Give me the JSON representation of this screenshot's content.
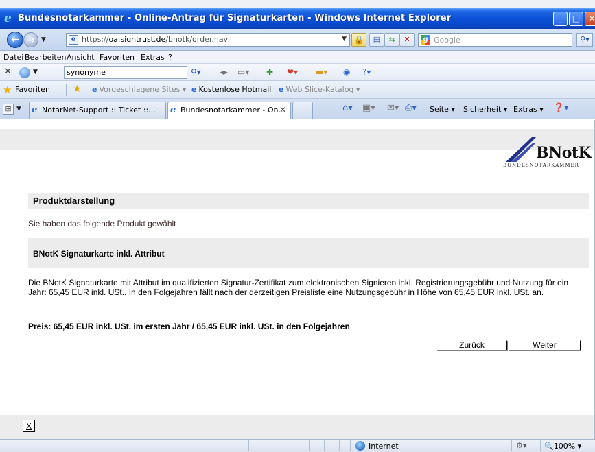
{
  "window": {
    "title": "Bundesnotarkammer - Online-Antrag für Signaturkarten - Windows Internet Explorer"
  },
  "address_bar": {
    "url_prefix": "https://",
    "url_domain": "oa.signtrust.de",
    "url_path": "/bnotk/order.nav",
    "search_placeholder": "Google"
  },
  "menu": {
    "items": [
      "Datei",
      "Bearbeiten",
      "Ansicht",
      "Favoriten",
      "Extras",
      "?"
    ]
  },
  "search_toolbar": {
    "query": "synonyme"
  },
  "favorites_bar": {
    "label": "Favoriten",
    "items": [
      "Vorgeschlagene Sites ▾",
      "Kostenlose Hotmail",
      "Web Slice-Katalog ▾"
    ]
  },
  "tabs": [
    {
      "label": "NotarNet-Support :: Ticket ::...",
      "active": false
    },
    {
      "label": "Bundesnotarkammer - On...",
      "active": true
    }
  ],
  "command_bar": {
    "page": "Seite ▾",
    "security": "Sicherheit ▾",
    "extras": "Extras ▾"
  },
  "page": {
    "logo_text": "BNotK",
    "logo_subtitle": "BUNDESNOTARKAMMER",
    "section_title": "Produktdarstellung",
    "chosen_text": "Sie haben das folgende Produkt gewählt",
    "product_name": "BNotK Signaturkarte inkl. Attribut",
    "description": "Die BNotK Signaturkarte mit Attribut im qualifizierten Signatur-Zertifikat zum elektronischen Signieren inkl. Registrierungsgebühr und Nutzung für ein Jahr: 65,45 EUR inkl. USt.. In den Folgejahren fällt nach der derzeitigen Preisliste eine Nutzungsgebühr in Höhe von 65,45 EUR inkl. USt. an.",
    "price": "Preis: 65,45 EUR inkl. USt. im ersten Jahr / 65,45 EUR inkl. USt. in den Folgejahren",
    "back_button": "Zurück",
    "next_button": "Weiter",
    "close_button": "X"
  },
  "status_bar": {
    "zone": "Internet",
    "zoom": "100%"
  },
  "colors": {
    "titlebar": "#0a4fd6",
    "page_band": "#ececec"
  }
}
